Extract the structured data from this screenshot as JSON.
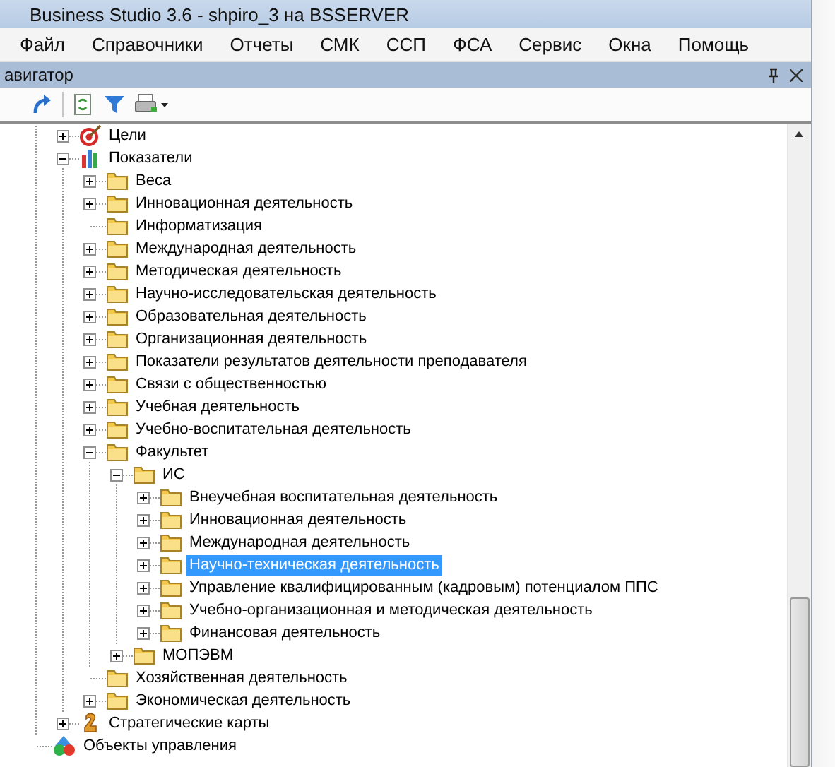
{
  "window": {
    "title": "Business Studio 3.6 - shpiro_3 на BSSERVER"
  },
  "menu": [
    "Файл",
    "Справочники",
    "Отчеты",
    "СМК",
    "ССП",
    "ФСА",
    "Сервис",
    "Окна",
    "Помощь"
  ],
  "panel": {
    "title": "авигатор"
  },
  "tree": [
    {
      "kind": "continued",
      "children": [
        {
          "label": "Цели",
          "kind": "target",
          "expanded": false,
          "selected": false
        },
        {
          "label": "Показатели",
          "kind": "chart",
          "expanded": true,
          "selected": false,
          "children": [
            {
              "label": "Веса",
              "kind": "folder",
              "expanded": false,
              "selected": false
            },
            {
              "label": "Инновационная деятельность",
              "kind": "folder",
              "expanded": false,
              "selected": false
            },
            {
              "label": "Информатизация",
              "kind": "folder",
              "selected": false
            },
            {
              "label": "Международная деятельность",
              "kind": "folder",
              "expanded": false,
              "selected": false
            },
            {
              "label": "Методическая деятельность",
              "kind": "folder",
              "expanded": false,
              "selected": false
            },
            {
              "label": "Научно-исследовательская деятельность",
              "kind": "folder",
              "expanded": false,
              "selected": false
            },
            {
              "label": "Образовательная деятельность",
              "kind": "folder",
              "expanded": false,
              "selected": false
            },
            {
              "label": "Организационная деятельность",
              "kind": "folder",
              "expanded": false,
              "selected": false
            },
            {
              "label": "Показатели результатов деятельности преподавателя",
              "kind": "folder",
              "expanded": false,
              "selected": false
            },
            {
              "label": "Связи с общественностью",
              "kind": "folder",
              "expanded": false,
              "selected": false
            },
            {
              "label": "Учебная деятельность",
              "kind": "folder",
              "expanded": false,
              "selected": false
            },
            {
              "label": "Учебно-воспитательная деятельность",
              "kind": "folder",
              "expanded": false,
              "selected": false
            },
            {
              "label": "Факультет",
              "kind": "folder",
              "expanded": true,
              "selected": false,
              "children": [
                {
                  "label": "ИС",
                  "kind": "folder",
                  "expanded": true,
                  "selected": false,
                  "children": [
                    {
                      "label": "Внеучебная воспитательная деятельность",
                      "kind": "folder",
                      "expanded": false,
                      "selected": false
                    },
                    {
                      "label": "Инновационная деятельность",
                      "kind": "folder",
                      "expanded": false,
                      "selected": false
                    },
                    {
                      "label": "Международная деятельность",
                      "kind": "folder",
                      "expanded": false,
                      "selected": false
                    },
                    {
                      "label": "Научно-техническая деятельность",
                      "kind": "folder",
                      "expanded": false,
                      "selected": true
                    },
                    {
                      "label": "Управление квалифицированным (кадровым) потенциалом ППС",
                      "kind": "folder",
                      "expanded": false,
                      "selected": false
                    },
                    {
                      "label": "Учебно-организационная и методическая деятельность",
                      "kind": "folder",
                      "expanded": false,
                      "selected": false
                    },
                    {
                      "label": "Финансовая деятельность",
                      "kind": "folder",
                      "expanded": false,
                      "selected": false
                    }
                  ]
                },
                {
                  "label": "МОПЭВМ",
                  "kind": "folder",
                  "expanded": false,
                  "selected": false
                }
              ]
            },
            {
              "label": "Хозяйственная деятельность",
              "kind": "folder",
              "selected": false
            },
            {
              "label": "Экономическая деятельность",
              "kind": "folder",
              "expanded": false,
              "selected": false
            }
          ]
        },
        {
          "label": "Стратегические карты",
          "kind": "pawn",
          "expanded": false,
          "selected": false
        }
      ]
    },
    {
      "label": "Объекты управления",
      "kind": "objects",
      "selected": false
    }
  ]
}
